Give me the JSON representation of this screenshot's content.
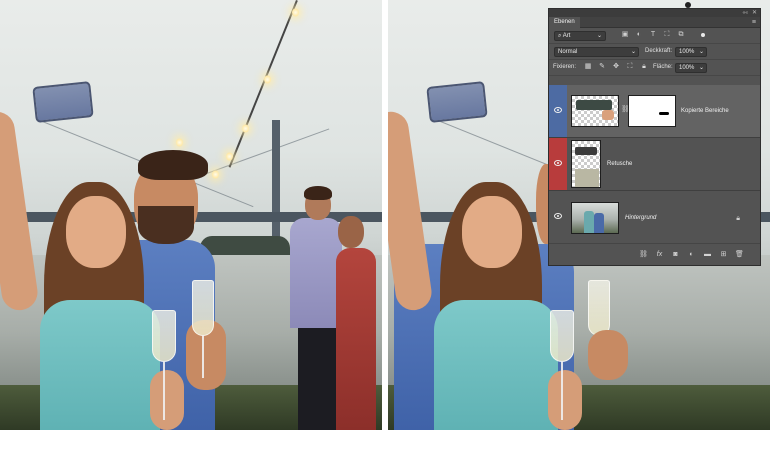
{
  "panel": {
    "tab_label": "Ebenen",
    "filter": {
      "kind_label": "Art",
      "icons": [
        "image-filter-icon",
        "adjustment-filter-icon",
        "type-filter-icon",
        "shape-filter-icon",
        "smartobject-filter-icon"
      ]
    },
    "blend_mode": "Normal",
    "opacity_label": "Deckkraft:",
    "opacity_value": "100%",
    "lock_label": "Fixieren:",
    "fill_label": "Fläche:",
    "fill_value": "100%",
    "layers": [
      {
        "name": "Kopierte Bereiche",
        "color": "#4d6ba3",
        "selected": true,
        "has_mask": true
      },
      {
        "name": "Retusche",
        "color": "#b83c3c",
        "selected": false,
        "has_mask": false
      },
      {
        "name": "Hintergrund",
        "color": "",
        "selected": false,
        "locked": true
      }
    ],
    "bottom_icons": [
      "link-icon",
      "fx-icon",
      "add-mask-icon",
      "adjustment-layer-icon",
      "group-icon",
      "new-layer-icon",
      "delete-icon"
    ]
  }
}
